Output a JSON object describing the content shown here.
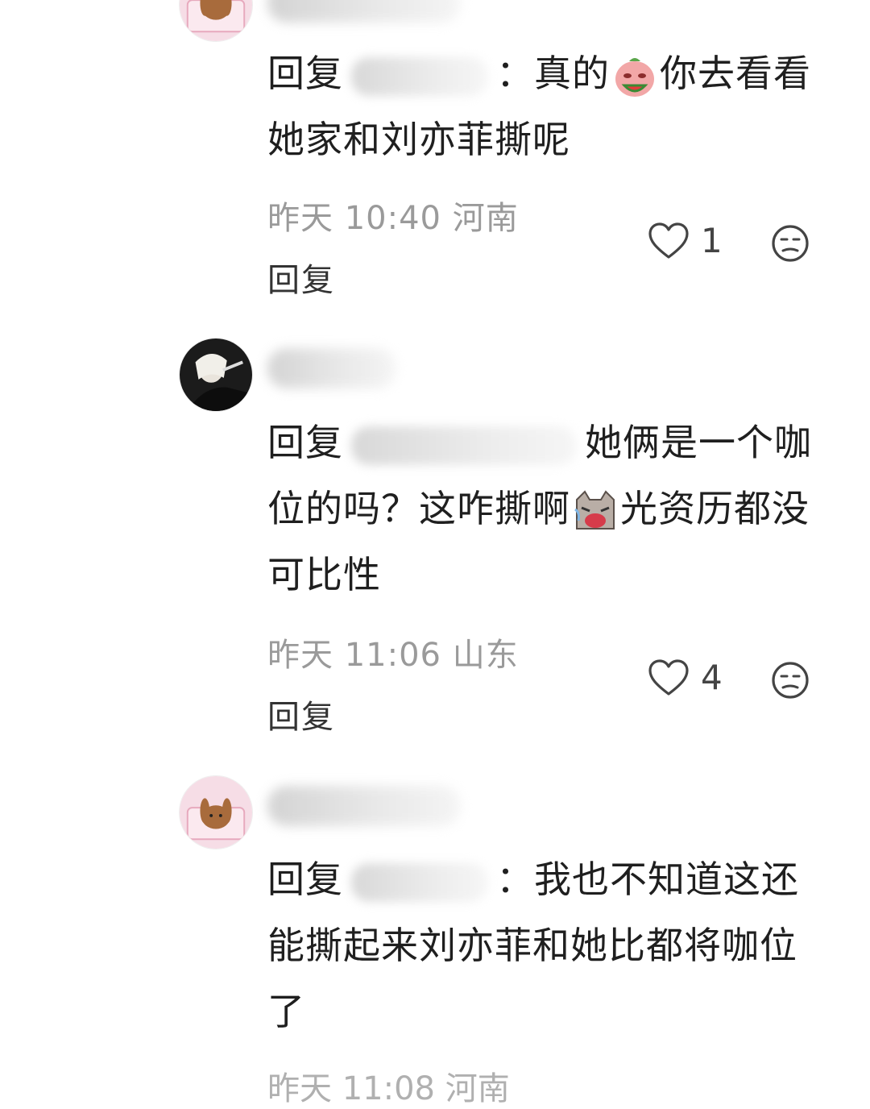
{
  "comments": [
    {
      "reply_prefix": "回复",
      "colon": "：",
      "text_a": "真的",
      "text_b": "你去看看她家和刘亦菲撕呢",
      "time": "昨天 10:40 河南",
      "reply_label": "回复",
      "likes": "1",
      "emoji_icon": "watermelon-face-emoji"
    },
    {
      "reply_prefix": "回复",
      "text_a": "她俩是一个咖位的吗？这咋撕啊",
      "text_b": "光资历都没可比性",
      "time": "昨天 11:06 山东",
      "reply_label": "回复",
      "likes": "4",
      "emoji_icon": "crying-cat-emoji"
    },
    {
      "reply_prefix": "回复",
      "colon": "：",
      "text_a": "我也不知道这还能撕起来刘亦菲和她比都将咖位了",
      "time_partial": "昨天 11:08 河南"
    }
  ],
  "icons": {
    "like": "heart-outline-icon",
    "dislike": "unamused-face-icon"
  },
  "colors": {
    "meta": "#9a9a9a",
    "text": "#1f1f1f",
    "icon": "#444444"
  }
}
